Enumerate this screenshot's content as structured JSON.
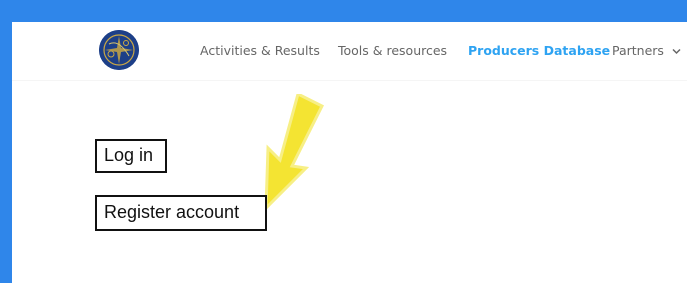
{
  "window": {
    "accent_color": "#2f86ea"
  },
  "header": {
    "logo_icon": "globe-logo-icon",
    "nav": [
      {
        "label": "Activities & Results",
        "active": false
      },
      {
        "label": "Tools & resources",
        "active": false
      },
      {
        "label": "Producers Database",
        "active": true
      },
      {
        "label": "Partners",
        "active": false,
        "has_dropdown": true
      }
    ],
    "dropdown_icon": "chevron-down-icon",
    "active_color": "#2ea3f2",
    "text_color": "#666666"
  },
  "main": {
    "login_label": "Log in",
    "register_label": "Register account",
    "annotation": {
      "icon": "arrow-down-left-icon",
      "color": "#f3e21c"
    }
  }
}
